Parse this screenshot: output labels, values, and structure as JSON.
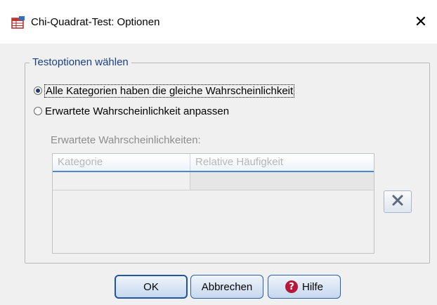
{
  "window": {
    "title": "Chi-Quadrat-Test: Optionen",
    "close_glyph": "✕",
    "app_icon": "spss-table-icon"
  },
  "test_options": {
    "legend": "Testoptionen wählen",
    "radio_all_equal": {
      "label": "Alle Kategorien haben die gleiche Wahrscheinlichkeit",
      "selected": true
    },
    "radio_custom": {
      "label": "Erwartete Wahrscheinlichkeit anpassen",
      "selected": false
    },
    "expected_label": "Erwartete Wahrscheinlichkeiten:",
    "table": {
      "columns": [
        "Kategorie",
        "Relative Häufigkeit"
      ],
      "rows": [
        [
          "",
          ""
        ]
      ]
    },
    "delete_icon": "delete-x-icon"
  },
  "buttons": {
    "ok": "OK",
    "cancel": "Abbrechen",
    "help": "Hilfe",
    "help_glyph": "?"
  },
  "colors": {
    "legend": "#1a3f8a",
    "disabled_text": "#8d8d8d",
    "button_border": "#2c5fa8",
    "help_icon": "#b5183b"
  }
}
